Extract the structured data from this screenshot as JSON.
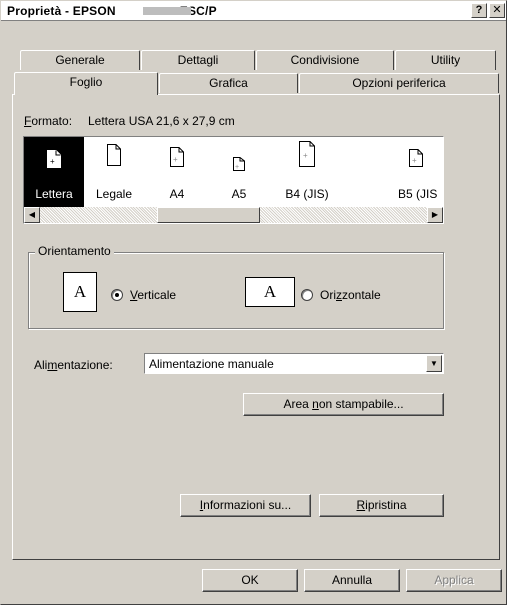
{
  "window": {
    "title": "Proprietà - EPSON",
    "title_model": "ESC/P",
    "help_button": "?",
    "close_button": "✕"
  },
  "tabs_row_back": [
    {
      "label": "Generale"
    },
    {
      "label": "Dettagli"
    },
    {
      "label": "Condivisione"
    },
    {
      "label": "Utility"
    }
  ],
  "tabs_row_front": [
    {
      "label": "Foglio",
      "active": true
    },
    {
      "label": "Grafica"
    },
    {
      "label": "Opzioni periferica"
    }
  ],
  "paper": {
    "format_label_u": "F",
    "format_label_rest": "ormato:",
    "format_value": "Lettera USA 21,6 x 27,9 cm",
    "items": [
      {
        "label": "Lettera",
        "selected": true
      },
      {
        "label": "Legale"
      },
      {
        "label": "A4"
      },
      {
        "label": "A5"
      },
      {
        "label": "B4 (JIS)"
      },
      {
        "label": "B5 (JIS"
      }
    ]
  },
  "orientation": {
    "group_label": "Orientamento",
    "icon_letter": "A",
    "portrait_u": "V",
    "portrait_rest": "erticale",
    "landscape_pre": "Ori",
    "landscape_u": "z",
    "landscape_rest": "zontale",
    "selected": "portrait"
  },
  "feed": {
    "label_pre": "Ali",
    "label_u": "m",
    "label_rest": "entazione:",
    "value": "Alimentazione manuale"
  },
  "buttons": {
    "unprintable_pre": "Area ",
    "unprintable_u": "n",
    "unprintable_rest": "on stampabile...",
    "info_u": "I",
    "info_rest": "nformazioni su...",
    "restore_u": "R",
    "restore_rest": "ipristina",
    "ok": "OK",
    "cancel": "Annulla",
    "apply": "Applica"
  }
}
